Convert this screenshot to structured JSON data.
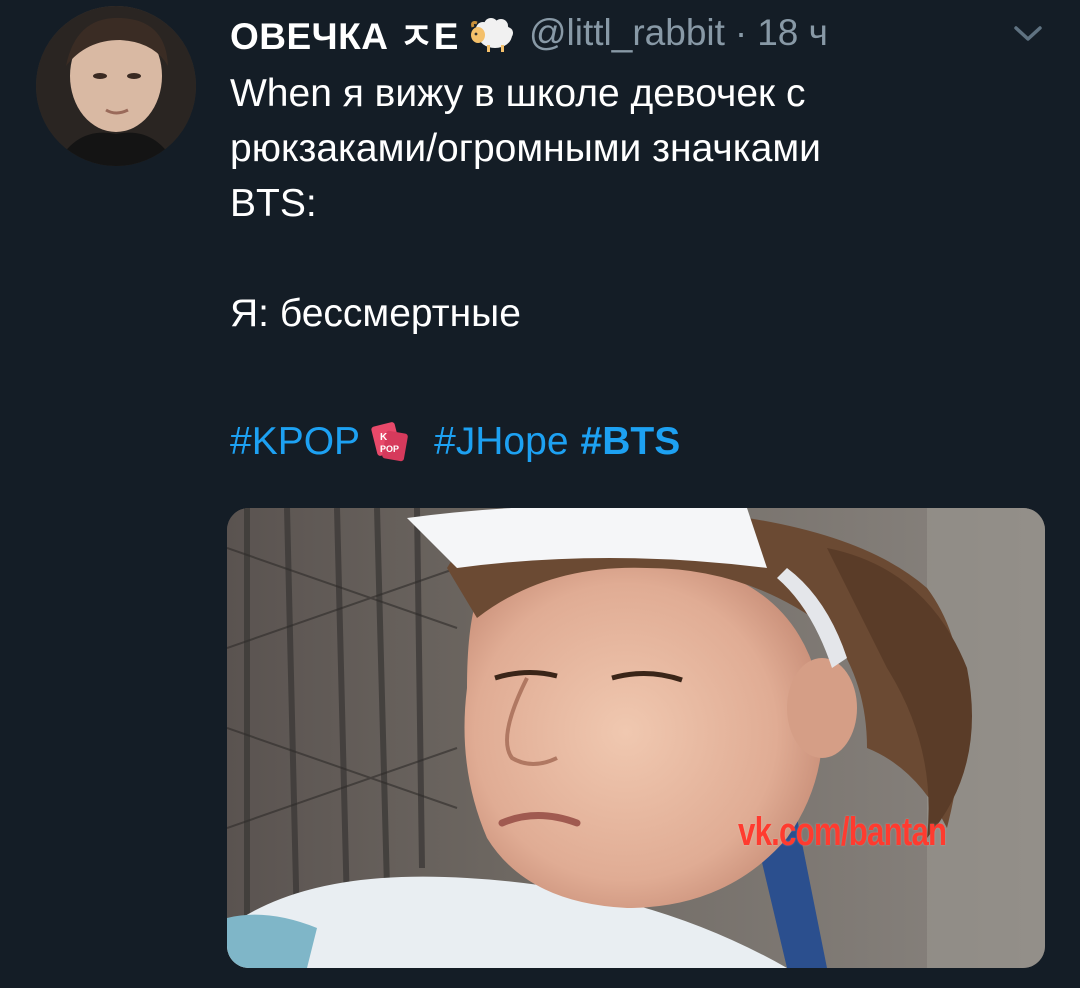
{
  "tweet": {
    "display_name": "ОВЕЧКА ㅈE",
    "handle": "@littl_rabbit",
    "separator": "·",
    "time": "18 ч",
    "body_lines": [
      "When я вижу в школе девочек с",
      "рюкзаками/огромными значками",
      "BTS:",
      "",
      "Я: бессмертные"
    ],
    "hashtags": [
      "#KPOP",
      "#JHope",
      "#BTS"
    ],
    "watermark": "vk.com/bantan"
  },
  "icons": {
    "sheep": "sheep-emoji-icon",
    "kpop": "kpop-badge-icon",
    "caret": "chevron-down-icon"
  },
  "colors": {
    "background": "#141d26",
    "text": "#ffffff",
    "muted": "#8899a6",
    "link": "#1da1f2",
    "watermark": "#ff3b2f"
  }
}
